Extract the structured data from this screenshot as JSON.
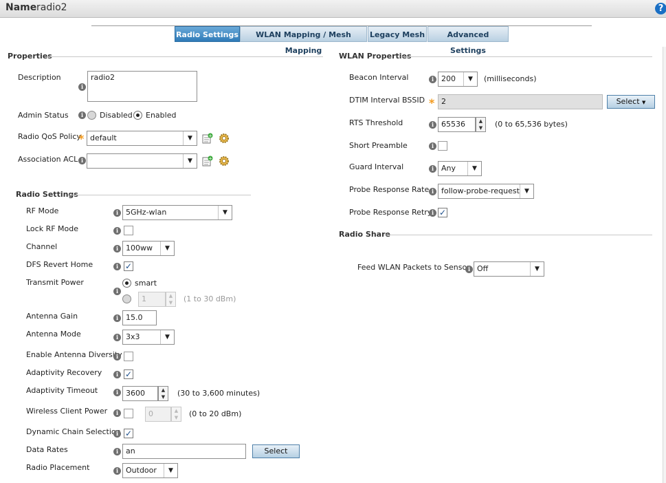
{
  "header": {
    "name_label": "Name",
    "name_value": "radio2",
    "help": "?"
  },
  "tabs": [
    {
      "label": "Radio Settings"
    },
    {
      "label": "WLAN Mapping / Mesh Mapping"
    },
    {
      "label": "Legacy Mesh"
    },
    {
      "label": "Advanced Settings"
    }
  ],
  "properties": {
    "title": "Properties",
    "description_label": "Description",
    "description_value": "radio2",
    "admin_status_label": "Admin Status",
    "admin_disabled": "Disabled",
    "admin_enabled": "Enabled",
    "qos_label": "Radio QoS Policy",
    "qos_value": "default",
    "acl_label": "Association ACL",
    "acl_value": ""
  },
  "radio_settings": {
    "title": "Radio Settings",
    "rf_mode_label": "RF Mode",
    "rf_mode_value": "5GHz-wlan",
    "lock_rf_label": "Lock RF Mode",
    "channel_label": "Channel",
    "channel_value": "100ww",
    "dfs_label": "DFS Revert Home",
    "tx_power_label": "Transmit Power",
    "tx_smart": "smart",
    "tx_value": "1",
    "tx_hint": "(1 to 30 dBm)",
    "antenna_gain_label": "Antenna Gain",
    "antenna_gain_value": "15.0",
    "antenna_mode_label": "Antenna Mode",
    "antenna_mode_value": "3x3",
    "diversity_label": "Enable Antenna Diversity",
    "adapt_recovery_label": "Adaptivity Recovery",
    "adapt_timeout_label": "Adaptivity Timeout",
    "adapt_timeout_value": "3600",
    "adapt_timeout_hint": "(30 to 3,600 minutes)",
    "wcp_label": "Wireless Client Power",
    "wcp_value": "0",
    "wcp_hint": "(0 to 20 dBm)",
    "dcs_label": "Dynamic Chain Selection",
    "data_rates_label": "Data Rates",
    "data_rates_value": "an",
    "data_rates_button": "Select",
    "placement_label": "Radio Placement",
    "placement_value": "Outdoor"
  },
  "wlan_properties": {
    "title": "WLAN Properties",
    "beacon_label": "Beacon Interval",
    "beacon_value": "200",
    "beacon_hint": "(milliseconds)",
    "dtim_label": "DTIM Interval BSSID",
    "dtim_value": "2",
    "dtim_button": "Select",
    "rts_label": "RTS Threshold",
    "rts_value": "65536",
    "rts_hint": "(0 to 65,536 bytes)",
    "preamble_label": "Short Preamble",
    "guard_label": "Guard Interval",
    "guard_value": "Any",
    "probe_rate_label": "Probe Response Rate",
    "probe_rate_value": "follow-probe-request",
    "probe_retry_label": "Probe Response Retry"
  },
  "radio_share": {
    "title": "Radio Share",
    "feed_label": "Feed WLAN Packets to Sensor",
    "feed_value": "Off"
  },
  "glyphs": {
    "info": "i",
    "req": "*",
    "check": "✓",
    "arrow": "▼",
    "up": "▲",
    "down": "▼"
  },
  "colors": {
    "accent": "#2f7bb8",
    "required": "#f39a1e",
    "info_icon": "#6f6f6f"
  }
}
